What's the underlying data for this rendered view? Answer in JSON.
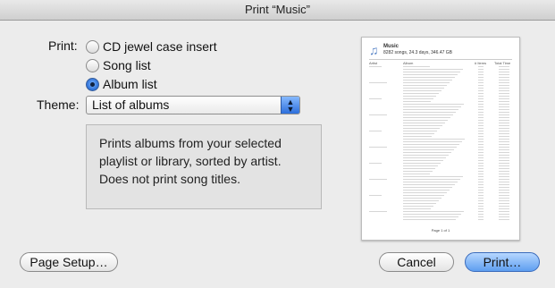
{
  "window": {
    "title": "Print “Music”"
  },
  "print_label": "Print:",
  "options": [
    {
      "label": "CD jewel case insert",
      "selected": false
    },
    {
      "label": "Song list",
      "selected": false
    },
    {
      "label": "Album list",
      "selected": true
    }
  ],
  "theme_label": "Theme:",
  "theme_value": "List of albums",
  "description": "Prints albums from your selected\nplaylist or library, sorted by artist.\nDoes not print song titles.",
  "preview": {
    "title": "Music",
    "subtitle": "8282 songs, 24.3 days, 346.47 GB",
    "col_artist": "Artist",
    "col_album": "Album",
    "col_count": "# Items",
    "col_time": "Total Time",
    "footer": "Page 1 of 1"
  },
  "buttons": {
    "page_setup": "Page Setup…",
    "cancel": "Cancel",
    "print": "Print…"
  }
}
